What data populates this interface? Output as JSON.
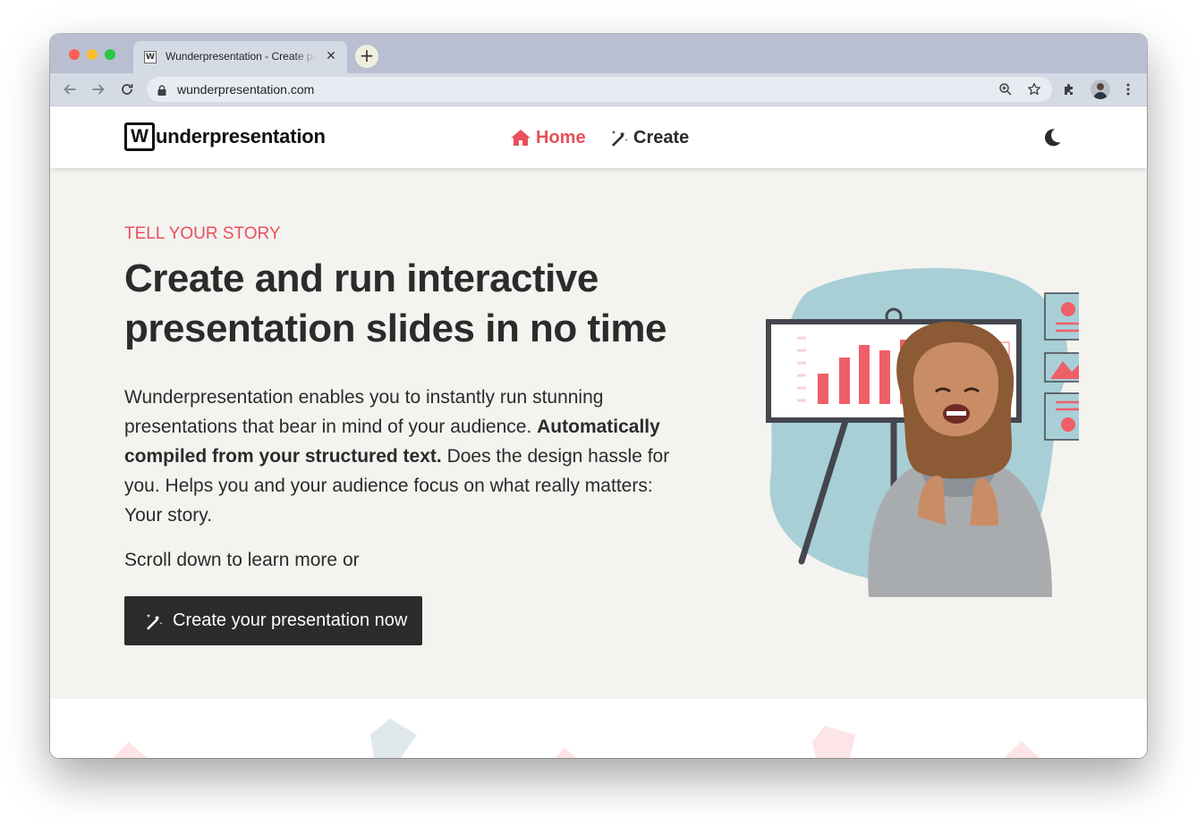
{
  "browser": {
    "tab": {
      "favicon_letter": "W",
      "title": "Wunderpresentation - Create presentations"
    },
    "new_tab_symbol": "+",
    "close_symbol": "✕",
    "url": "wunderpresentation.com"
  },
  "site": {
    "logo": {
      "box_letter": "W",
      "rest": "underpresentation"
    },
    "nav": {
      "home": "Home",
      "create": "Create"
    },
    "accent_color": "#e8505b",
    "dark_color": "#2b2b2b"
  },
  "hero": {
    "eyebrow": "TELL YOUR STORY",
    "headline": "Create and run interactive presentation slides in no time",
    "lead_part1": "Wunderpresentation enables you to instantly run stunning presentations that bear in mind of your audience. ",
    "lead_bold": "Automatically compiled from your structured text.",
    "lead_part2": " Does the design hassle for you. Helps you and your audience focus on what really matters: Your story.",
    "scroll_hint": "Scroll down to learn more or",
    "cta_label": "Create your presentation now"
  },
  "icons": {
    "back": "back-arrow-icon",
    "forward": "forward-arrow-icon",
    "reload": "reload-icon",
    "lock": "lock-icon",
    "zoom": "zoom-icon",
    "bookmark": "star-icon",
    "extensions": "puzzle-icon",
    "menu": "kebab-menu-icon",
    "home": "house-icon",
    "create": "magic-wand-icon",
    "theme": "moon-icon"
  }
}
